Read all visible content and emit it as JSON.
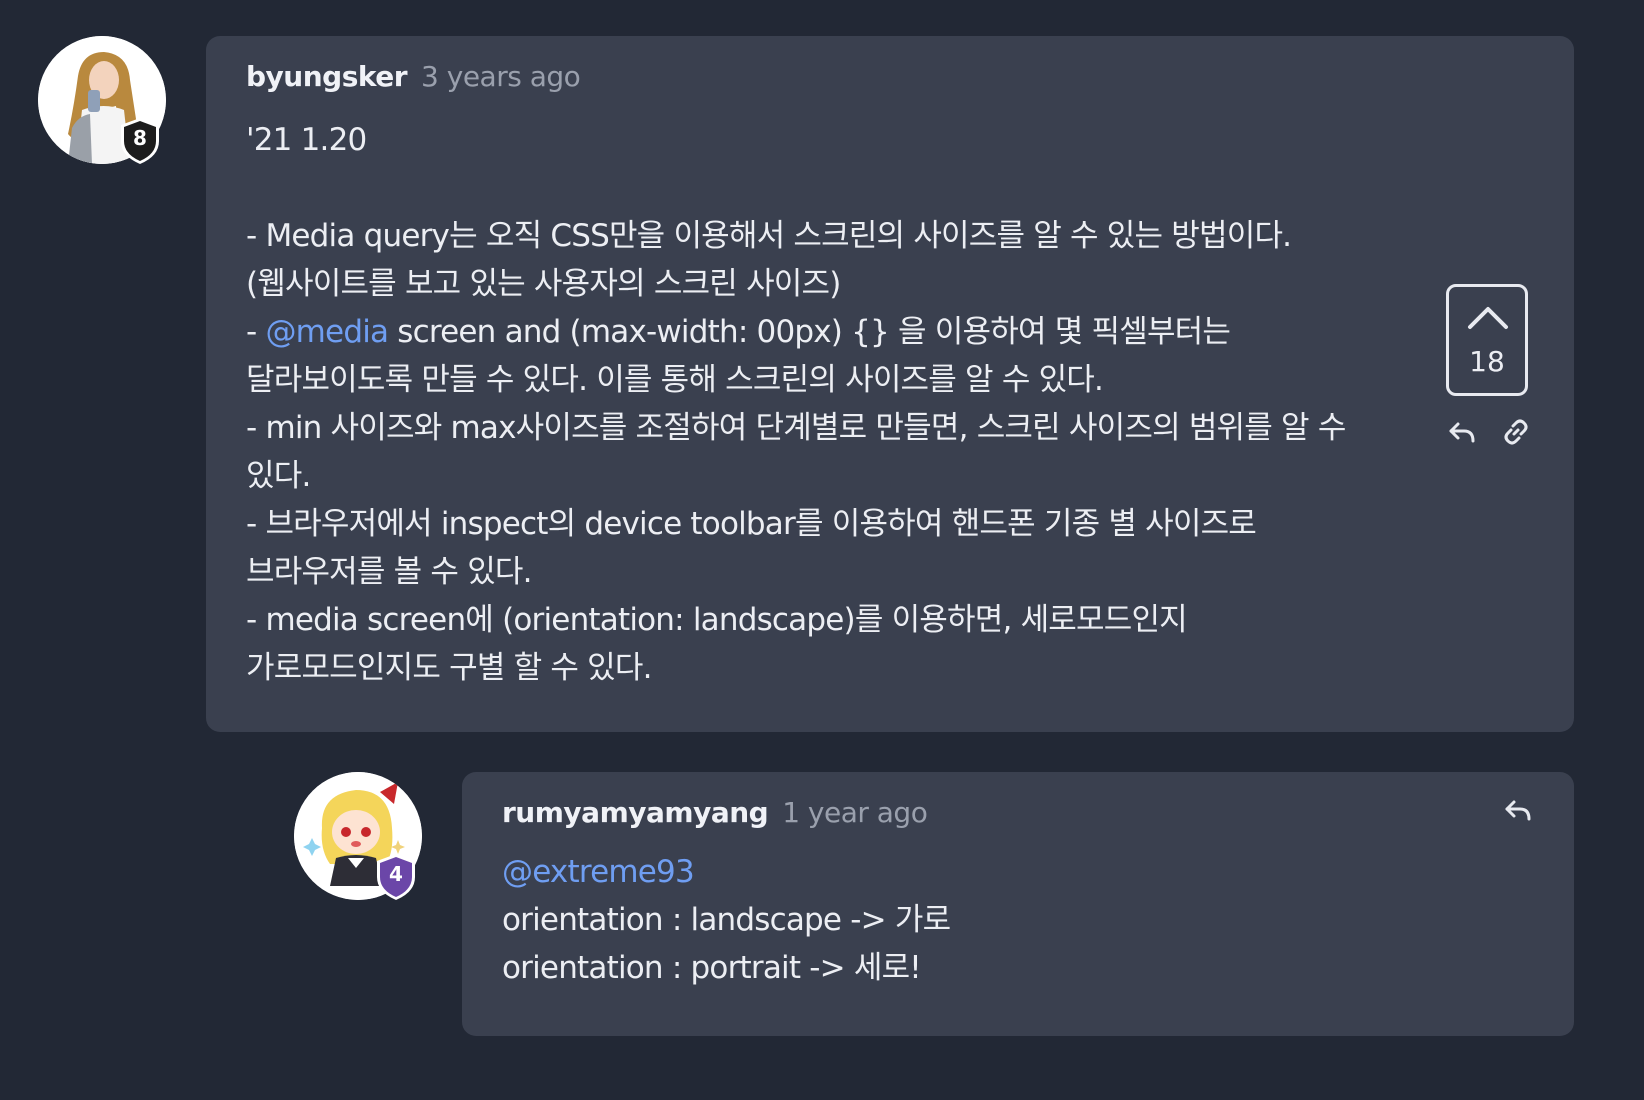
{
  "comments": [
    {
      "author": "byungsker",
      "time": "3 years ago",
      "avatar": "long-haired-person-selfie",
      "badge": {
        "number": "8",
        "color": "#1d1d1d"
      },
      "lines": [
        {
          "text": "'21 1.20"
        },
        {
          "text": ""
        },
        {
          "text": "- Media query는 오직 CSS만을 이용해서 스크린의 사이즈를 알 수 있는 방법이다."
        },
        {
          "text": "(웹사이트를 보고 있는 사용자의 스크린 사이즈)"
        },
        {
          "prefix": "- ",
          "mention": "@media",
          "text": " screen and (max-width: 00px) {} 을 이용하여 몇 픽셀부터는"
        },
        {
          "text": "달라보이도록 만들 수 있다. 이를 통해 스크린의 사이즈를 알 수 있다."
        },
        {
          "text": "- min 사이즈와 max사이즈를 조절하여 단계별로 만들면, 스크린 사이즈의 범위를 알 수"
        },
        {
          "text": "있다."
        },
        {
          "text": "- 브라우저에서 inspect의 device toolbar를 이용하여 핸드폰 기종 별 사이즈로"
        },
        {
          "text": "브라우저를 볼 수 있다."
        },
        {
          "text": "- media screen에 (orientation: landscape)를 이용하면, 세로모드인지"
        },
        {
          "text": "가로모드인지도 구별 할 수 있다."
        }
      ],
      "upvotes": "18",
      "actions": [
        "reply-icon",
        "link-icon",
        "chevron-up-icon"
      ]
    },
    {
      "author": "rumyamyamyang",
      "time": "1 year ago",
      "avatar": "blonde-anime-character",
      "badge": {
        "number": "4",
        "color": "#6b46a8"
      },
      "lines": [
        {
          "mention": "@extreme93",
          "text": ""
        },
        {
          "text": "orientation : landscape -> 가로"
        },
        {
          "text": "orientation : portrait -> 세로!"
        }
      ],
      "actions": [
        "reply-icon"
      ]
    }
  ],
  "colors": {
    "background": "#222835",
    "card": "#3a404f",
    "mention": "#6f9ef2",
    "muted": "#9aa0ad"
  }
}
